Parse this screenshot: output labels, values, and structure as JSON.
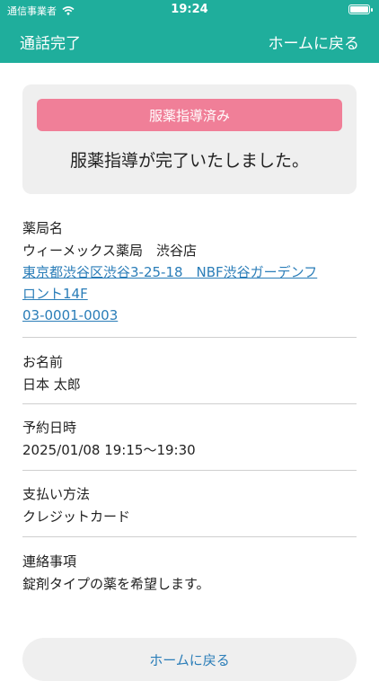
{
  "status_bar": {
    "carrier": "通信事業者",
    "time": "19:24"
  },
  "nav": {
    "left": "通話完了",
    "right": "ホームに戻る"
  },
  "summary": {
    "badge": "服薬指導済み",
    "message": "服薬指導が完了いたしました。"
  },
  "pharmacy": {
    "label": "薬局名",
    "name": "ウィーメックス薬局　渋谷店",
    "address_line1": "東京都渋谷区渋谷3-25-18　NBF渋谷ガーデンフ",
    "address_line2": "ロント14F",
    "phone": "03-0001-0003"
  },
  "patient": {
    "label": "お名前",
    "value": "日本 太郎"
  },
  "reservation": {
    "label": "予約日時",
    "value": "2025/01/08 19:15～19:30"
  },
  "payment": {
    "label": "支払い方法",
    "value": "クレジットカード"
  },
  "notes": {
    "label": "連絡事項",
    "value": "錠剤タイプの薬を希望します。"
  },
  "footer": {
    "home_button": "ホームに戻る"
  },
  "colors": {
    "header": "#1fae9c",
    "badge": "#f07f98",
    "link": "#2a7db8"
  }
}
